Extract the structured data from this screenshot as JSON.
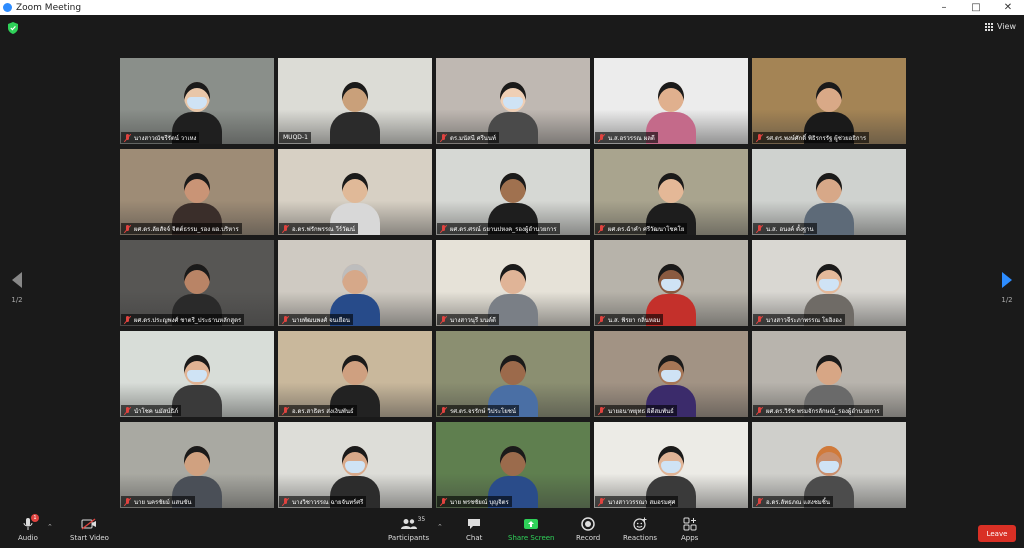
{
  "window": {
    "title": "Zoom Meeting",
    "controls": [
      "minimize",
      "maximize",
      "close"
    ]
  },
  "top_bar": {
    "security_icon": "shield-check-icon",
    "view_label": "View"
  },
  "pagination": {
    "left_indicator": "1/2",
    "right_indicator": "1/2"
  },
  "participants_grid": [
    {
      "name": "นางสาวณัชรีรัตน์ วาเหง",
      "muted": true,
      "bg": "#8a8f8a",
      "skin": "#e8c6a8",
      "shirt": "#1f1f1f",
      "hair": "#1a1a1a",
      "mask": true
    },
    {
      "name": "MUQD-1",
      "muted": false,
      "bg": "#dcdcd6",
      "skin": "#c9a07a",
      "shirt": "#2b2b2b",
      "hair": "#1a1a1a",
      "mask": false,
      "active": true
    },
    {
      "name": "ดร.มนัสนี ศรีนนท์",
      "muted": true,
      "bg": "#bfb8b2",
      "skin": "#efcfb5",
      "shirt": "#4a4a4a",
      "hair": "#1a1a1a",
      "mask": true
    },
    {
      "name": "น.ส.อรวรรณ ผลดี",
      "muted": true,
      "bg": "#ececec",
      "skin": "#e0b08e",
      "shirt": "#c46a8a",
      "hair": "#1a1a1a",
      "mask": false
    },
    {
      "name": "รศ.ดร.พงษ์ศักดิ์ พิธิรกรรัฐ ผู้ช่วยอธิการ",
      "muted": true,
      "bg": "#a48455",
      "skin": "#d9a987",
      "shirt": "#1a1a1a",
      "hair": "#1a1a1a",
      "mask": false
    },
    {
      "name": "ผศ.ดร.ลัยสัจจ์ จิตต์ธรรม_รอง ผอ.บริหาร",
      "muted": true,
      "bg": "#9e8c76",
      "skin": "#c99476",
      "shirt": "#3a2e2a",
      "hair": "#1a1a1a",
      "mask": false
    },
    {
      "name": "อ.ดร.ฟรักพรรณ วีร์วัฒน์",
      "muted": true,
      "bg": "#d7d0c4",
      "skin": "#e0b998",
      "shirt": "#d8d8d8",
      "hair": "#1a1a1a",
      "mask": false
    },
    {
      "name": "ผศ.ดร.ศรณ์ ธยานปหงค_รองผู้อำนวยการ",
      "muted": true,
      "bg": "#d6d8d4",
      "skin": "#a0714f",
      "shirt": "#1e1e1e",
      "hair": "#1a1a1a",
      "mask": false
    },
    {
      "name": "ผศ.ดร.ฉำคำ ศรีวัฒนาโชคโย",
      "muted": true,
      "bg": "#a9a48e",
      "skin": "#e4b897",
      "shirt": "#1d1d1d",
      "hair": "#1a1a1a",
      "mask": false
    },
    {
      "name": "น.ส. อนงค์ ตั้งฐาน",
      "muted": true,
      "bg": "#cfd2cf",
      "skin": "#d7a888",
      "shirt": "#5d6a78",
      "hair": "#1a1a1a",
      "mask": false
    },
    {
      "name": "ผศ.ดร.ประญพงศ์ ชาตรี_ประธานหลักสูตร",
      "muted": true,
      "bg": "#575654",
      "skin": "#b98466",
      "shirt": "#2a2a2a",
      "hair": "#1a1a1a",
      "mask": false
    },
    {
      "name": "นายพัฒนพงศ์ จนเยือน",
      "muted": true,
      "bg": "#cfcac2",
      "skin": "#d6a889",
      "shirt": "#274b8a",
      "hair": "#bdbdbd",
      "mask": false
    },
    {
      "name": "นางสาวนุรี มนต์ดี",
      "muted": true,
      "bg": "#e6e2d8",
      "skin": "#e0b497",
      "shirt": "#7a7f86",
      "hair": "#1a1a1a",
      "mask": false
    },
    {
      "name": "น.ส. พิรยา กลิ่นหอม",
      "muted": true,
      "bg": "#b7b3aa",
      "skin": "#8a5a40",
      "shirt": "#c4302b",
      "hair": "#1a1a1a",
      "mask": true
    },
    {
      "name": "นางสาวจีระภาพรรณ โยอิงอง",
      "muted": true,
      "bg": "#d9d7d2",
      "skin": "#e4b99a",
      "shirt": "#6f6b66",
      "hair": "#1a1a1a",
      "mask": true
    },
    {
      "name": "นำโชค นมัสน์ธิภ์",
      "muted": true,
      "bg": "#d8ddd8",
      "skin": "#e0b394",
      "shirt": "#3a3a3a",
      "hair": "#1a1a1a",
      "mask": true
    },
    {
      "name": "อ.ดร.สาธิตร ส่งเงินพันธ์",
      "muted": true,
      "bg": "#c9b89c",
      "skin": "#cfa080",
      "shirt": "#222222",
      "hair": "#1a1a1a",
      "mask": false
    },
    {
      "name": "รศ.ดร.จรรักษ์ วิประโยชน์",
      "muted": true,
      "bg": "#8b8f71",
      "skin": "#9c6a4b",
      "shirt": "#4a6fa5",
      "hair": "#1a1a1a",
      "mask": false
    },
    {
      "name": "นายอนาทยุทธ ผิดีสมพันธ์",
      "muted": true,
      "bg": "#a29384",
      "skin": "#a67656",
      "shirt": "#3b2b6b",
      "hair": "#1a1a1a",
      "mask": true
    },
    {
      "name": "ผศ.ดร.วิรัช พรมจักรลักษณ์_รองผู้อำนวยการ",
      "muted": true,
      "bg": "#b8b4ad",
      "skin": "#d7a685",
      "shirt": "#6a6a6a",
      "hair": "#1a1a1a",
      "mask": false
    },
    {
      "name": "นาย นครชัยม์ แสนขัน",
      "muted": true,
      "bg": "#a9a9a2",
      "skin": "#d0a180",
      "shirt": "#4a4f57",
      "hair": "#1a1a1a",
      "mask": false
    },
    {
      "name": "นางวิชาวรรณ ฉายจันทร์ศรี",
      "muted": true,
      "bg": "#ddddd8",
      "skin": "#d8a98a",
      "shirt": "#2c2c2c",
      "hair": "#1a1a1a",
      "mask": true
    },
    {
      "name": "นาย พรชชัยณ์ บุญจิตร",
      "muted": true,
      "bg": "#5f7f4f",
      "skin": "#9b6b4c",
      "shirt": "#2a4c8a",
      "hair": "#1a1a1a",
      "mask": false
    },
    {
      "name": "นางสาววรรณา สมอรมศุศ",
      "muted": true,
      "bg": "#ecebe6",
      "skin": "#e0b496",
      "shirt": "#3a3a3a",
      "hair": "#1a1a1a",
      "mask": true
    },
    {
      "name": "อ.ดร.ลัทธภณ แสงชมชิ้น",
      "muted": true,
      "bg": "#cfcfcb",
      "skin": "#c98f6e",
      "shirt": "#4c4c4c",
      "hair": "#d07a3a",
      "mask": true
    }
  ],
  "toolbar": {
    "audio": {
      "label": "Audio",
      "badge": "1",
      "icon": "mic-muted-icon"
    },
    "video": {
      "label": "Start Video",
      "icon": "video-off-icon"
    },
    "participants": {
      "label": "Participants",
      "count": "35",
      "icon": "people-icon"
    },
    "chat": {
      "label": "Chat",
      "icon": "chat-bubble-icon"
    },
    "share": {
      "label": "Share Screen",
      "icon": "share-screen-icon",
      "color": "#2fd159"
    },
    "record": {
      "label": "Record",
      "icon": "record-icon"
    },
    "reactions": {
      "label": "Reactions",
      "icon": "smiley-plus-icon"
    },
    "apps": {
      "label": "Apps",
      "icon": "apps-icon"
    },
    "leave": {
      "label": "Leave",
      "color": "#d93025"
    }
  }
}
